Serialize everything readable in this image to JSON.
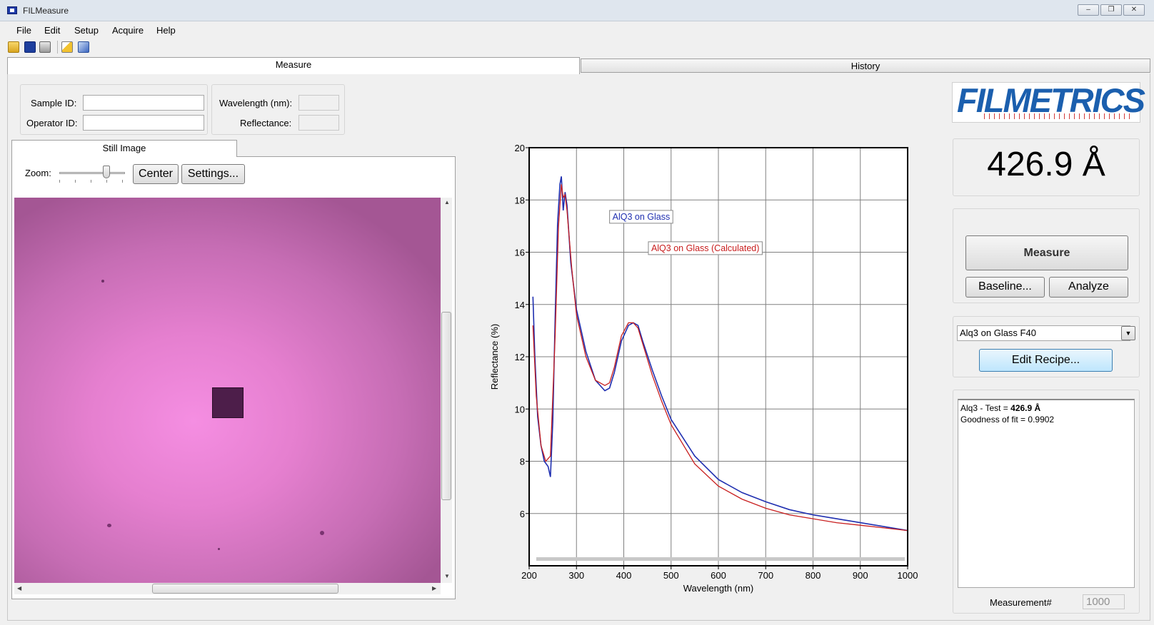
{
  "window": {
    "title": "FILMeasure",
    "controls": {
      "minimize": "–",
      "restore": "❐",
      "close": "✕"
    }
  },
  "menu": [
    "File",
    "Edit",
    "Setup",
    "Acquire",
    "Help"
  ],
  "toolbar_icons": [
    "open-folder-icon",
    "save-icon",
    "print-icon",
    "new-icon",
    "copy-icon"
  ],
  "tabs": {
    "measure": "Measure",
    "history": "History"
  },
  "sample": {
    "sample_id_label": "Sample ID:",
    "sample_id_value": "",
    "operator_id_label": "Operator ID:",
    "operator_id_value": ""
  },
  "cursor_readout": {
    "wavelength_label": "Wavelength (nm):",
    "wavelength_value": "",
    "reflectance_label": "Reflectance:",
    "reflectance_value": ""
  },
  "image_panel": {
    "tab_label": "Still Image",
    "zoom_label": "Zoom:",
    "zoom_level": 0.72,
    "center_button": "Center",
    "settings_button": "Settings..."
  },
  "chart_data": {
    "type": "line",
    "xlabel": "Wavelength (nm)",
    "ylabel": "Reflectance (%)",
    "xlim": [
      200,
      1000
    ],
    "ylim": [
      4,
      20
    ],
    "xticks": [
      200,
      300,
      400,
      500,
      600,
      700,
      800,
      900,
      1000
    ],
    "yticks": [
      6,
      8,
      10,
      12,
      14,
      16,
      18,
      20
    ],
    "grid": true,
    "series": [
      {
        "name": "AlQ3 on Glass",
        "color": "#1f2fb0",
        "x": [
          208,
          212,
          218,
          225,
          232,
          240,
          245,
          250,
          255,
          260,
          265,
          268,
          272,
          276,
          280,
          288,
          300,
          320,
          340,
          360,
          370,
          380,
          395,
          410,
          420,
          430,
          440,
          460,
          480,
          500,
          550,
          600,
          650,
          700,
          750,
          800,
          850,
          900,
          950,
          1000
        ],
        "y": [
          14.3,
          12.0,
          9.7,
          8.6,
          8.0,
          7.8,
          7.4,
          9.5,
          13.5,
          17.1,
          18.6,
          18.9,
          17.6,
          18.3,
          17.8,
          15.6,
          13.8,
          12.2,
          11.1,
          10.7,
          10.8,
          11.4,
          12.6,
          13.2,
          13.3,
          13.2,
          12.6,
          11.5,
          10.5,
          9.6,
          8.2,
          7.3,
          6.8,
          6.45,
          6.15,
          5.95,
          5.8,
          5.65,
          5.5,
          5.35
        ]
      },
      {
        "name": "AlQ3 on Glass (Calculated)",
        "color": "#c81e1e",
        "x": [
          208,
          215,
          225,
          235,
          245,
          255,
          262,
          268,
          272,
          276,
          280,
          290,
          300,
          320,
          340,
          360,
          370,
          380,
          395,
          410,
          420,
          430,
          440,
          460,
          480,
          500,
          550,
          600,
          650,
          700,
          750,
          800,
          850,
          900,
          950,
          1000
        ],
        "y": [
          13.2,
          10.5,
          8.6,
          8.0,
          8.2,
          12.8,
          17.0,
          18.6,
          18.1,
          18.2,
          17.6,
          15.4,
          13.6,
          12.0,
          11.1,
          10.9,
          11.0,
          11.6,
          12.8,
          13.3,
          13.3,
          13.1,
          12.5,
          11.3,
          10.3,
          9.4,
          7.9,
          7.05,
          6.55,
          6.2,
          5.95,
          5.8,
          5.65,
          5.55,
          5.45,
          5.35
        ]
      }
    ]
  },
  "result": {
    "thickness": "426.9 Å"
  },
  "actions": {
    "measure": "Measure",
    "baseline": "Baseline...",
    "analyze": "Analyze",
    "edit_recipe": "Edit Recipe..."
  },
  "recipe": {
    "selected": "Alq3 on Glass F40"
  },
  "results_text": {
    "line1_prefix": "Alq3 - Test = ",
    "line1_value": "426.9 Å",
    "line2": "Goodness of fit = 0.9902"
  },
  "measurement_counter": {
    "label": "Measurement#",
    "value": "1000"
  },
  "colors": {
    "logo_blue": "#1b5fae",
    "logo_red": "#d23a3a",
    "image_pink": "#f58ee2"
  }
}
